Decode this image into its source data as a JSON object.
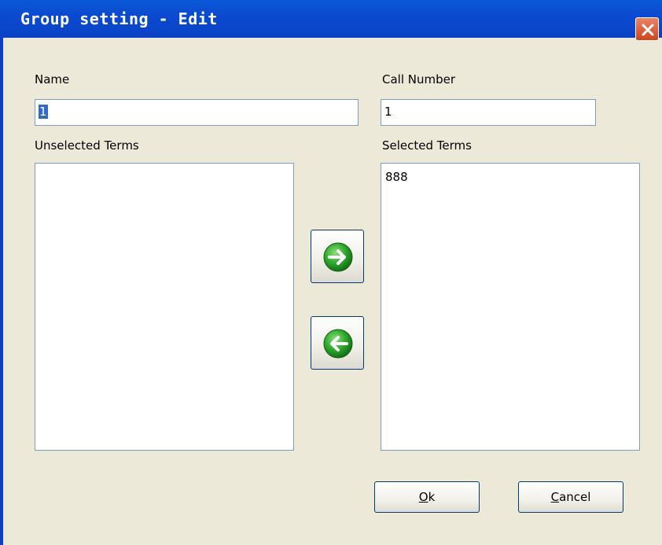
{
  "window": {
    "title": "Group setting - Edit",
    "close_icon": "close-icon",
    "titlebar_color": "#0a4ad0",
    "close_color": "#d9532c"
  },
  "form": {
    "name_label": "Name",
    "name_value": "1",
    "call_number_label": "Call Number",
    "call_number_value": "1",
    "unselected_label": "Unselected Terms",
    "unselected_items": [],
    "selected_label": "Selected Terms",
    "selected_items": [
      "888"
    ]
  },
  "buttons": {
    "move_right_icon": "arrow-right-icon",
    "move_left_icon": "arrow-left-icon",
    "ok_mnemonic": "O",
    "ok_rest": "k",
    "cancel_mnemonic": "C",
    "cancel_rest": "ancel",
    "arrow_color": "#2aa52a"
  }
}
